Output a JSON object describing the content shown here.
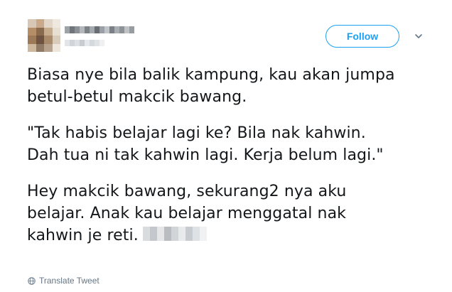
{
  "header": {
    "follow_label": "Follow",
    "caret_icon": "chevron-down-icon"
  },
  "tweet": {
    "paragraphs": [
      [
        "Biasa nye bila balik kampung, kau akan jumpa",
        "betul-betul makcik bawang."
      ],
      [
        "\"Tak habis belajar lagi ke? Bila nak kahwin.",
        "Dah tua ni tak kahwin lagi. Kerja belum lagi.\""
      ],
      [
        "Hey makcik bawang, sekurang2 nya aku",
        "belajar. Anak kau belajar menggatal nak",
        "kahwin je reti."
      ]
    ]
  },
  "footer": {
    "translate_label": "Translate Tweet",
    "globe_icon": "globe-icon"
  },
  "colors": {
    "accent": "#1da1f2",
    "text": "#14171a",
    "muted": "#657786"
  }
}
